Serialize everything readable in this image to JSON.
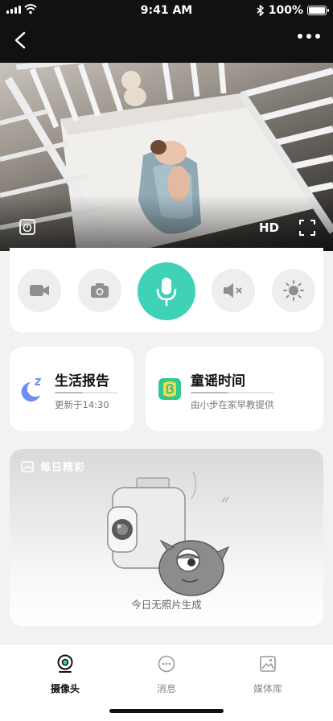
{
  "status_bar": {
    "time": "9:41 AM",
    "battery": "100%"
  },
  "nav": {
    "back_icon": "chevron-left-icon",
    "more_icon": "more-dots-icon"
  },
  "video": {
    "quality": "HD"
  },
  "controls": [
    {
      "name": "video-record-button",
      "icon": "video-camera-icon"
    },
    {
      "name": "snapshot-button",
      "icon": "camera-icon"
    },
    {
      "name": "talk-button",
      "icon": "microphone-icon"
    },
    {
      "name": "mute-button",
      "icon": "speaker-mute-icon"
    },
    {
      "name": "brightness-button",
      "icon": "sun-icon"
    }
  ],
  "cards": {
    "report": {
      "title": "生活报告",
      "subtitle": "更新于14:30"
    },
    "songs": {
      "title": "童谣时间",
      "subtitle": "由小步在家早教提供"
    }
  },
  "daily": {
    "title": "每日精彩",
    "empty_text": "今日无照片生成"
  },
  "tabs": [
    {
      "label": "摄像头",
      "active": true
    },
    {
      "label": "消息",
      "active": false
    },
    {
      "label": "媒体库",
      "active": false
    }
  ],
  "colors": {
    "accent": "#3fd2b6",
    "nav_bg": "#111114",
    "moon": "#6d8ff2"
  }
}
